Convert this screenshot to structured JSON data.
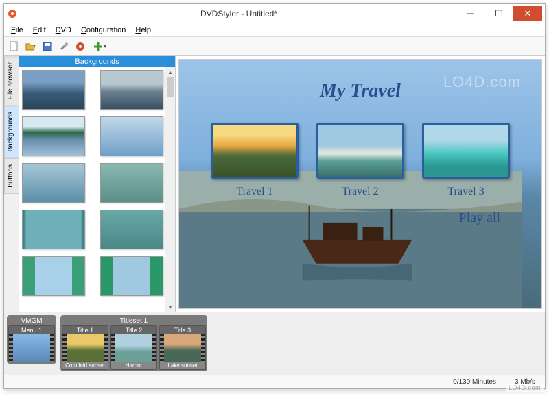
{
  "window": {
    "title": "DVDStyler - Untitled*"
  },
  "menubar": [
    "File",
    "Edit",
    "DVD",
    "Configuration",
    "Help"
  ],
  "toolbar_icons": [
    "new-icon",
    "open-icon",
    "save-icon",
    "settings-icon",
    "burn-icon",
    "add-icon"
  ],
  "side_tabs": [
    {
      "label": "File browser",
      "active": false
    },
    {
      "label": "Backgrounds",
      "active": true
    },
    {
      "label": "Buttons",
      "active": false
    }
  ],
  "panel": {
    "header": "Backgrounds",
    "thumbs": [
      {
        "bg": "linear-gradient(#7aa0c8 30%,#3a5a78 60%,#28465a)"
      },
      {
        "bg": "linear-gradient(#b8c8d0 35%,#6a8090 55%,#3a5060)"
      },
      {
        "bg": "linear-gradient(#d8e8f0 25%,#2a6a4a 40%,#6a90b0 60%,#a0c0d8)"
      },
      {
        "bg": "linear-gradient(#c0d8e8,#70a0c8)"
      },
      {
        "bg": "linear-gradient(#a8c8d8,#5a90a8)"
      },
      {
        "bg": "linear-gradient(#8ab8b0,#5a9088)"
      },
      {
        "bg": "linear-gradient(90deg,#3a8088 2%,#70b0b8 6%,#70b0b8 94%,#3a8088 98%)"
      },
      {
        "bg": "linear-gradient(#6aa8a8,#4a8888)"
      },
      {
        "bg": "linear-gradient(90deg,#3aa078 20%,#a8d0e8 20% 80%,#3aa078 80%)"
      },
      {
        "bg": "linear-gradient(90deg,#2a9868 20%,#a0c8e0 20% 80%,#2a9868 80%)"
      }
    ]
  },
  "preview": {
    "title": "My Travel",
    "items": [
      {
        "label": "Travel 1",
        "bg": "linear-gradient(#f8d880 20%,#e8a840 40%,#4a6a3a 60%,#3a5028)"
      },
      {
        "label": "Travel 2",
        "bg": "linear-gradient(#a0c8e0 40%,#e8e8e0 55%,#5aa098 70%,#3a7068)"
      },
      {
        "label": "Travel 3",
        "bg": "linear-gradient(#b0d8e8 30%,#4ac8c0 55%,#2a9890 80%)"
      }
    ],
    "play_all": "Play all",
    "watermark": "LO4D.com"
  },
  "timeline": {
    "vmgm": {
      "header": "VMGM",
      "items": [
        {
          "title": "Menu 1",
          "caption": "",
          "bg": "linear-gradient(#88b8e8,#5a88b8)"
        }
      ]
    },
    "titleset": {
      "header": "Titleset 1",
      "items": [
        {
          "title": "Title 1",
          "caption": "Cornfield sunset",
          "bg": "linear-gradient(#e8c868 35%,#5a7038 60%)"
        },
        {
          "title": "Title 2",
          "caption": "Harbor",
          "bg": "linear-gradient(#b0d0e0 40%,#6aa098 65%)"
        },
        {
          "title": "Title 3",
          "caption": "Lake sunset",
          "bg": "linear-gradient(#d8a878 35%,#4a6858 60%)"
        }
      ]
    }
  },
  "status": {
    "minutes": "0/130 Minutes",
    "bitrate": "3 Mb/s"
  },
  "corner_watermark": "LO4D.com"
}
